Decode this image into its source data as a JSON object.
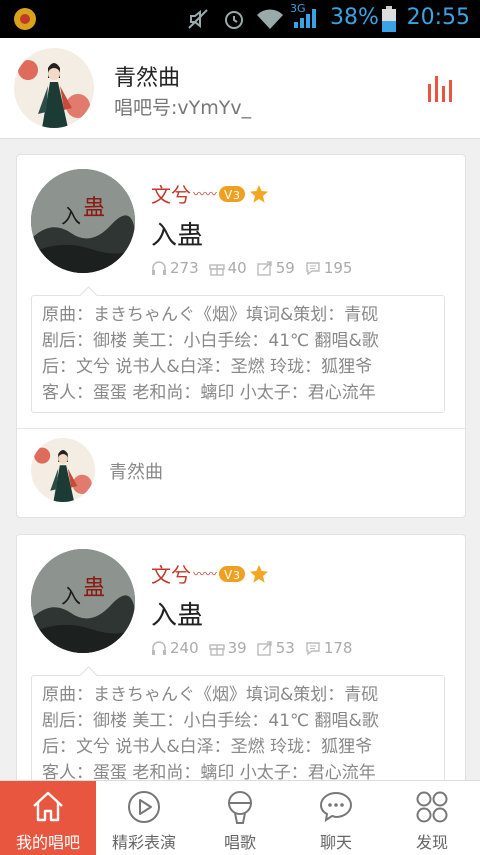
{
  "status_bar": {
    "network": "3G",
    "battery": "38%",
    "time": "20:55"
  },
  "header": {
    "name": "青然曲",
    "user_id": "唱吧号:vYmYv_"
  },
  "cards": [
    {
      "author": "文兮",
      "level": "3",
      "title": "入蛊",
      "listens": "273",
      "gifts": "40",
      "shares": "59",
      "comments": "195",
      "desc": [
        "原曲：まきちゃんぐ《烟》填词&策划：青砚",
        "剧后：御楼 美工：小白手绘：41℃ 翻唱&歌",
        "后：文兮 说书人&白泽：圣燃 玲珑：狐狸爷",
        "客人：蛋蛋 老和尚：螭印 小太子：君心流年"
      ],
      "poster": "青然曲"
    },
    {
      "author": "文兮",
      "level": "3",
      "title": "入蛊",
      "listens": "240",
      "gifts": "39",
      "shares": "53",
      "comments": "178",
      "desc": [
        "原曲：まきちゃんぐ《烟》填词&策划：青砚",
        "剧后：御楼 美工：小白手绘：41℃ 翻唱&歌",
        "后：文兮 说书人&白泽：圣燃 玲珑：狐狸爷",
        "客人：蛋蛋 老和尚：螭印 小太子：君心流年"
      ]
    }
  ],
  "nav": [
    {
      "label": "我的唱吧",
      "icon": "home-icon"
    },
    {
      "label": "精彩表演",
      "icon": "play-icon"
    },
    {
      "label": "唱歌",
      "icon": "microphone-icon"
    },
    {
      "label": "聊天",
      "icon": "chat-icon"
    },
    {
      "label": "发现",
      "icon": "discover-icon"
    }
  ],
  "colors": {
    "accent": "#e8563f",
    "author": "#c0392b",
    "status": "#3aa3e3"
  }
}
